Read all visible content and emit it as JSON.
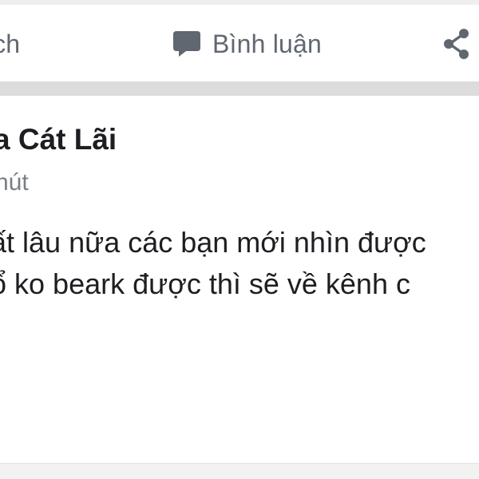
{
  "actions": {
    "like_label": "hích",
    "comment_label": "Bình luận",
    "comment_icon": "comment-bubble-icon",
    "share_icon": "share-icon"
  },
  "post": {
    "author": "a Cát Lãi",
    "time": "hút",
    "body_lines": [
      "ất lâu nữa các bạn mới nhìn được",
      "ổ ko beark được thì sẽ về kênh c"
    ]
  },
  "colors": {
    "text_primary": "#1c1e21",
    "text_secondary": "#606770",
    "divider": "#dcdcdc",
    "background": "#ffffff"
  }
}
